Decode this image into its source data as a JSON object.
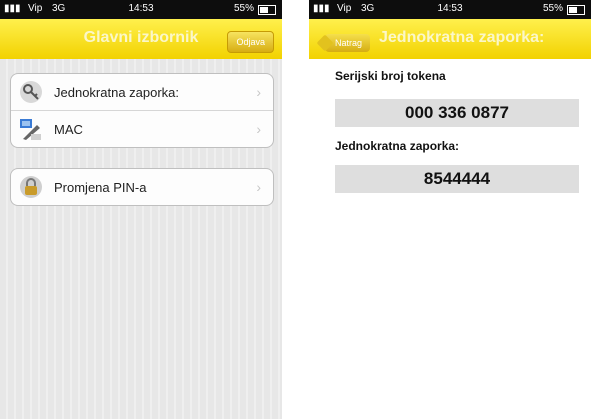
{
  "status": {
    "carrier": "Vip",
    "network": "3G",
    "time": "14:53",
    "battery": "55%"
  },
  "main_menu": {
    "title": "Glavni izbornik",
    "logout_label": "Odjava",
    "items": [
      {
        "label": "Jednokratna zaporka:",
        "icon": "key-icon"
      },
      {
        "label": "MAC",
        "icon": "pen-icon"
      },
      {
        "label": "Promjena PIN-a",
        "icon": "lock-icon"
      }
    ]
  },
  "otp_screen": {
    "title": "Jednokratna zaporka:",
    "back_label": "Natrag",
    "serial_label": "Serijski broj tokena",
    "serial_value": "000 336 0877",
    "otp_label": "Jednokratna zaporka:",
    "otp_value": "8544444"
  },
  "colors": {
    "accent_yellow": "#f2d200",
    "status_bar": "#0d0d0d",
    "field_bg": "#dedede"
  }
}
